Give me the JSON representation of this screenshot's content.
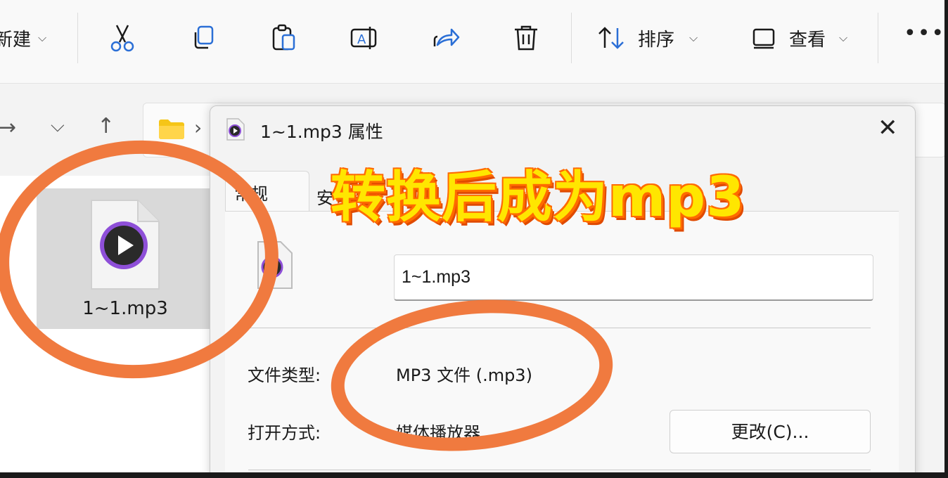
{
  "toolbar": {
    "new_label": "新建",
    "sort_label": "排序",
    "view_label": "查看",
    "more_label": "•••"
  },
  "nav": {
    "forward_glyph": "→",
    "dropdown_glyph": "⌵",
    "up_glyph": "↑",
    "crumb_chevron": "›"
  },
  "file": {
    "name": "1~1.mp3"
  },
  "dialog": {
    "title": "1~1.mp3 属性",
    "close_glyph": "✕",
    "tabs": [
      {
        "label": "常规",
        "active": true
      },
      {
        "label": "安",
        "active": false
      }
    ],
    "file_name_value": "1~1.mp3",
    "file_type_label": "文件类型:",
    "file_type_value": "MP3 文件 (.mp3)",
    "opens_with_label": "打开方式:",
    "opens_with_value": "媒体播放器",
    "change_button": "更改(C)..."
  },
  "overlay": {
    "caption": "转换后成为mp3",
    "ring_color": "#f07a3f",
    "caption_color": "#ffe600",
    "caption_outline": "#ff6a00"
  }
}
